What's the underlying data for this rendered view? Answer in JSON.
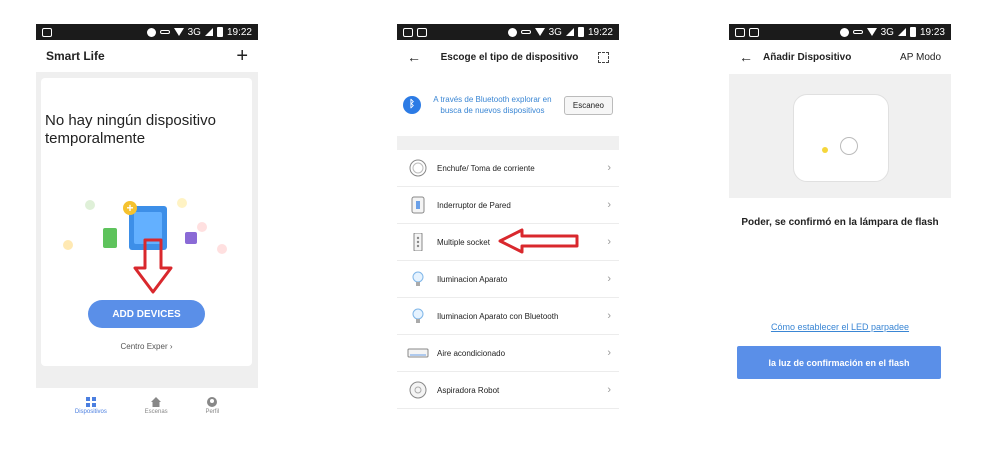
{
  "status_bars": [
    {
      "time": "19:22",
      "network": "3G"
    },
    {
      "time": "19:22",
      "network": "3G"
    },
    {
      "time": "19:23",
      "network": "3G"
    }
  ],
  "screen1": {
    "title": "Smart Life",
    "add_icon": "plus-icon",
    "empty_message": "No hay ningún dispositivo temporalmente",
    "add_devices_label": "ADD DEVICES",
    "centro_label": "Centro Exper ›",
    "nav": [
      {
        "label": "Dispositivos",
        "icon": "grid-icon",
        "active": true
      },
      {
        "label": "Escenas",
        "icon": "home-icon",
        "active": false
      },
      {
        "label": "Perfil",
        "icon": "profile-icon",
        "active": false
      }
    ]
  },
  "screen2": {
    "title": "Escoge el tipo de dispositivo",
    "bluetooth_text": "A través de Bluetooth explorar en busca de nuevos dispositivos",
    "scan_label": "Escaneo",
    "devices": [
      {
        "label": "Enchufe/ Toma de corriente",
        "icon": "plug-icon"
      },
      {
        "label": "Inderruptor de Pared",
        "icon": "wall-switch-icon"
      },
      {
        "label": "Multiple socket",
        "icon": "power-strip-icon"
      },
      {
        "label": "Iluminacion Aparato",
        "icon": "bulb-icon"
      },
      {
        "label": "Iluminacion Aparato con Bluetooth",
        "icon": "bulb-icon"
      },
      {
        "label": "Aire acondicionado",
        "icon": "air-conditioner-icon"
      },
      {
        "label": "Aspiradora Robot",
        "icon": "robot-vacuum-icon"
      }
    ]
  },
  "screen3": {
    "title": "Añadir Dispositivo",
    "mode_label": "AP Modo",
    "instruction": "Poder, se confirmó en la lámpara de flash",
    "help_link": "Cómo establecer el LED parpadee",
    "confirm_label": "la luz de confirmación en el flash"
  },
  "colors": {
    "accent": "#5a8fe8",
    "link": "#3a86d4",
    "annotation_arrow": "#d9282d"
  }
}
